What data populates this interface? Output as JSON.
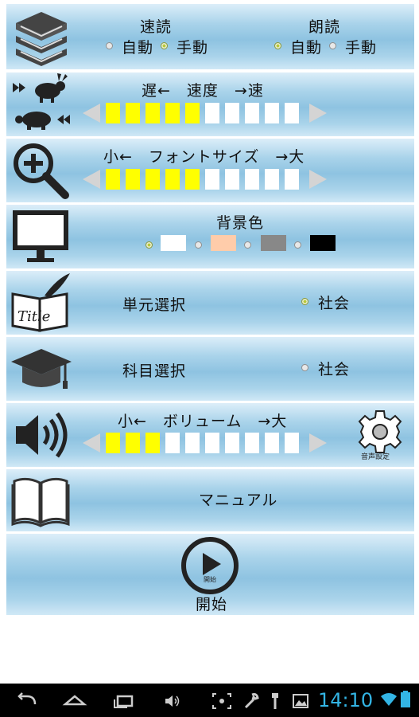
{
  "reading": {
    "speed_reading": {
      "title": "速読",
      "options": [
        "自動",
        "手動"
      ],
      "selected": "手動"
    },
    "read_aloud": {
      "title": "朗読",
      "options": [
        "自動",
        "手動"
      ],
      "selected": "自動"
    }
  },
  "speed": {
    "label": "遅←　速度　→速",
    "level": 5,
    "max": 10
  },
  "font_size": {
    "label": "小←　フォントサイズ　→大",
    "level": 5,
    "max": 10
  },
  "background": {
    "label": "背景色",
    "swatches": [
      "#ffffff",
      "#ffccaa",
      "#888888",
      "#000000"
    ],
    "selected_index": 0
  },
  "unit": {
    "label": "単元選択",
    "value": "社会"
  },
  "subject": {
    "label": "科目選択",
    "value": "社会"
  },
  "volume": {
    "label": "小←　ボリューム　→大",
    "level": 3,
    "max": 10,
    "settings_icon_text": "音声設定"
  },
  "manual": {
    "label": "マニュアル"
  },
  "start": {
    "label": "開始",
    "icon_text": "開始"
  },
  "statusbar": {
    "time": "14:10"
  },
  "colors": {
    "accent": "#33b5e5",
    "bar_on": "#ffff00"
  }
}
